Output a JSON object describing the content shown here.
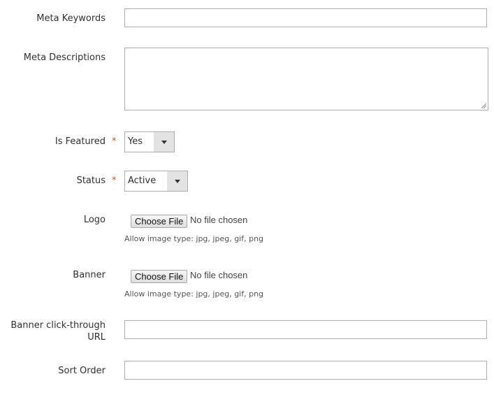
{
  "fields": {
    "meta_keywords": {
      "label": "Meta Keywords",
      "value": ""
    },
    "meta_descriptions": {
      "label": "Meta Descriptions",
      "value": ""
    },
    "is_featured": {
      "label": "Is Featured",
      "required": "*",
      "value": "Yes"
    },
    "status": {
      "label": "Status",
      "required": "*",
      "value": "Active"
    },
    "logo": {
      "label": "Logo",
      "button": "Choose File",
      "file_status": "No file chosen",
      "note": "Allow image type: jpg, jpeg, gif, png"
    },
    "banner": {
      "label": "Banner",
      "button": "Choose File",
      "file_status": "No file chosen",
      "note": "Allow image type: jpg, jpeg, gif, png"
    },
    "banner_url": {
      "label_line1": "Banner click-through",
      "label_line2": "URL",
      "value": ""
    },
    "sort_order": {
      "label": "Sort Order",
      "value": ""
    }
  },
  "colors": {
    "required_star": "#eb5202",
    "border": "#adadad"
  }
}
